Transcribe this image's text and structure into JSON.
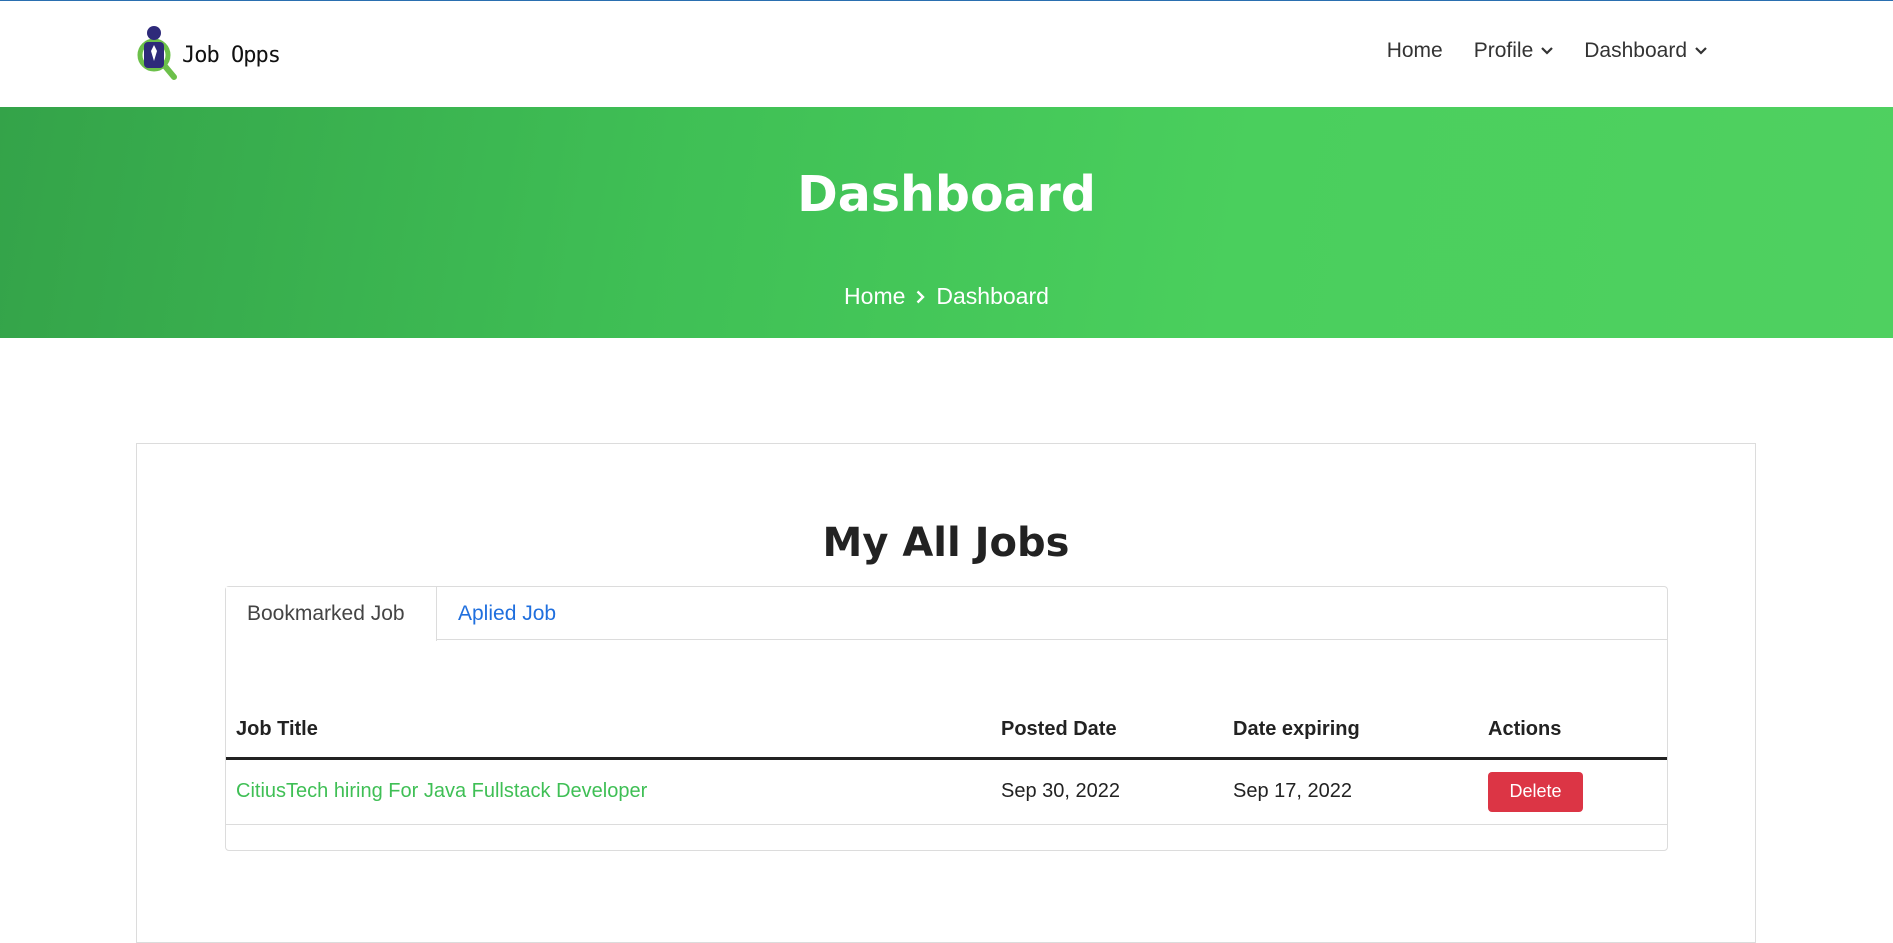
{
  "header": {
    "logo_text": "Job Opps",
    "nav": [
      {
        "label": "Home",
        "has_dropdown": false
      },
      {
        "label": "Profile",
        "has_dropdown": true
      },
      {
        "label": "Dashboard",
        "has_dropdown": true
      }
    ]
  },
  "hero": {
    "title": "Dashboard",
    "breadcrumb": [
      "Home",
      "Dashboard"
    ]
  },
  "main": {
    "title": "My All Jobs",
    "tabs": [
      {
        "label": "Bookmarked Job",
        "active": true
      },
      {
        "label": "Aplied Job",
        "active": false
      }
    ],
    "table": {
      "columns": [
        "Job Title",
        "Posted Date",
        "Date expiring",
        "Actions"
      ],
      "rows": [
        {
          "title": "CitiusTech hiring For Java Fullstack Developer",
          "posted": "Sep 30, 2022",
          "expiring": "Sep 17, 2022",
          "action": "Delete"
        }
      ]
    }
  },
  "colors": {
    "accent_green": "#4acf5d",
    "delete_red": "#dc3545",
    "tab_link_blue": "#1f6fde"
  }
}
